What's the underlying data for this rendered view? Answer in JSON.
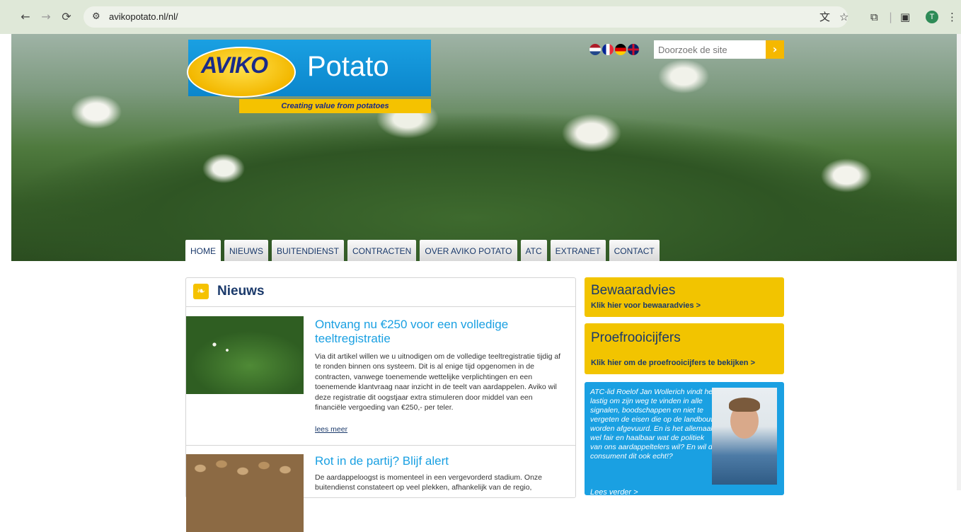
{
  "browser": {
    "url": "avikopotato.nl/nl/",
    "profile_initial": "T"
  },
  "header": {
    "logo_brand": "AVIKO",
    "logo_product": "Potato",
    "tagline": "Creating value from potatoes",
    "search_placeholder": "Doorzoek de site",
    "languages": [
      "nl",
      "fr",
      "de",
      "en"
    ]
  },
  "nav": {
    "tabs": [
      {
        "label": "HOME",
        "active": true
      },
      {
        "label": "NIEUWS"
      },
      {
        "label": "BUITENDIENST"
      },
      {
        "label": "CONTRACTEN"
      },
      {
        "label": "OVER AVIKO POTATO"
      },
      {
        "label": "ATC"
      },
      {
        "label": "EXTRANET"
      },
      {
        "label": "CONTACT"
      }
    ]
  },
  "news": {
    "title": "Nieuws",
    "articles": [
      {
        "title": "Ontvang nu €250 voor een volledige teeltregistratie",
        "body": "Via dit artikel willen we u uitnodigen om de volledige teeltregistratie tijdig af te ronden binnen ons systeem. Dit is al enige tijd opgenomen in de contracten, vanwege toenemende wettelijke verplichtingen en een toenemende klantvraag naar inzicht in de teelt van aardappelen. Aviko wil deze registratie dit oogstjaar extra stimuleren door middel van een financiële vergoeding van €250,- per teler.",
        "more": "lees meer"
      },
      {
        "title": "Rot in de partij? Blijf alert",
        "body": "De aardappeloogst is momenteel in een vergevorderd stadium. Onze buitendienst constateert op veel plekken, afhankelijk van de regio,"
      }
    ]
  },
  "sidebar": {
    "bewaaradvies": {
      "title": "Bewaaradvies",
      "link": "Klik hier voor bewaaradvies >"
    },
    "proefrooi": {
      "title": "Proefrooicijfers",
      "link": "Klik hier om de proefrooicijfers te bekijken >"
    },
    "atc": {
      "text": "ATC-lid Roelof Jan Wollerich vindt het lastig om zijn weg te vinden in alle signalen, boodschappen en niet te vergeten de eisen die op de landbouw worden afgevuurd. En is het allemaal wel fair en haalbaar wat de politiek van ons aardappeltelers wil? En wil de consument dit ook echt!?",
      "more": "Lees verder >"
    }
  },
  "colors": {
    "accent_blue": "#1aa0e2",
    "accent_yellow": "#f2c400",
    "navy": "#1b3a6b"
  }
}
